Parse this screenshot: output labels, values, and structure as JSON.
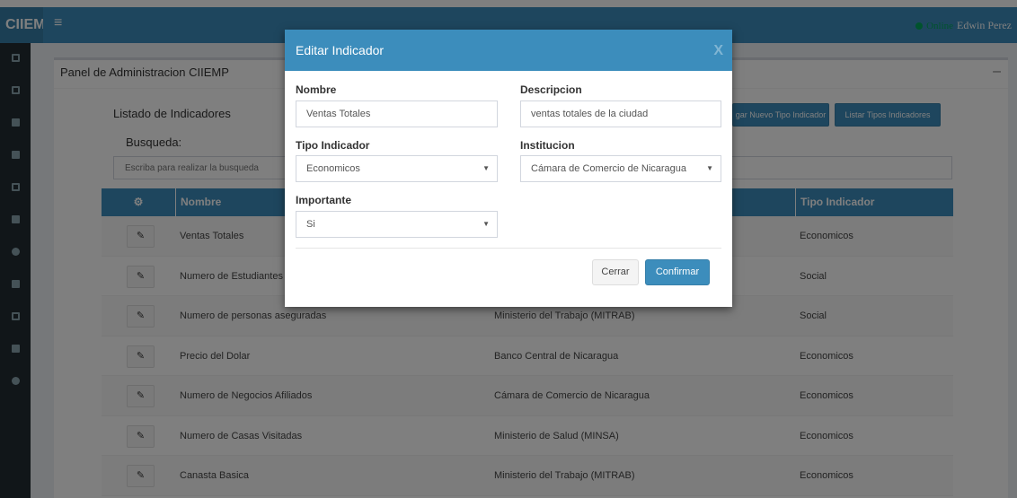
{
  "app": {
    "brand": "CIIEM",
    "hamburger_icon": "≡",
    "user": {
      "status": "Online",
      "name": "Edwin Perez"
    }
  },
  "sidebar": {
    "icons": [
      "monitor-icon",
      "keyboard-icon",
      "line-chart-icon",
      "bar-chart-icon",
      "pdf-icon",
      "building-icon",
      "chat-icon",
      "file-icon",
      "image-icon",
      "plus-square-icon",
      "info-icon"
    ]
  },
  "panel": {
    "title": "Panel de Administracion CIIEMP",
    "collapse": "–"
  },
  "listado": {
    "title": "Listado de Indicadores",
    "btn_agregar_tipo": "gar Nuevo Tipo Indicador",
    "btn_listar_tipos": "Listar Tipos Indicadores",
    "busqueda_label": "Busqueda:",
    "search_placeholder": "Escriba para realizar la busqueda"
  },
  "table": {
    "columns": {
      "gear": "⚙",
      "nombre": "Nombre",
      "tipo": "Tipo Indicador"
    },
    "rows": [
      {
        "nombre": "Ventas Totales",
        "institucion": "",
        "tipo": "Economicos"
      },
      {
        "nombre": "Numero de Estudiantes",
        "institucion": "",
        "tipo": "Social"
      },
      {
        "nombre": "Numero de personas aseguradas",
        "institucion": "Ministerio del Trabajo (MITRAB)",
        "tipo": "Social"
      },
      {
        "nombre": "Precio del Dolar",
        "institucion": "Banco Central de Nicaragua",
        "tipo": "Economicos"
      },
      {
        "nombre": "Numero de Negocios Afiliados",
        "institucion": "Cámara de Comercio de Nicaragua",
        "tipo": "Economicos"
      },
      {
        "nombre": "Numero de Casas Visitadas",
        "institucion": "Ministerio de Salud (MINSA)",
        "tipo": "Economicos"
      },
      {
        "nombre": "Canasta Basica",
        "institucion": "Ministerio del Trabajo (MITRAB)",
        "tipo": "Economicos"
      }
    ]
  },
  "modal": {
    "title": "Editar Indicador",
    "close": "X",
    "nombre_label": "Nombre",
    "nombre_value": "Ventas Totales",
    "descripcion_label": "Descripcion",
    "descripcion_value": "ventas totales de la ciudad",
    "tipo_label": "Tipo Indicador",
    "tipo_value": "Economicos",
    "institucion_label": "Institucion",
    "institucion_value": "Cámara de Comercio de Nicaragua",
    "importante_label": "Importante",
    "importante_value": "Si",
    "cerrar": "Cerrar",
    "confirmar": "Confirmar"
  },
  "colors": {
    "primary": "#3c8dbc",
    "sidebar": "#222d32",
    "online": "#00a65a"
  }
}
